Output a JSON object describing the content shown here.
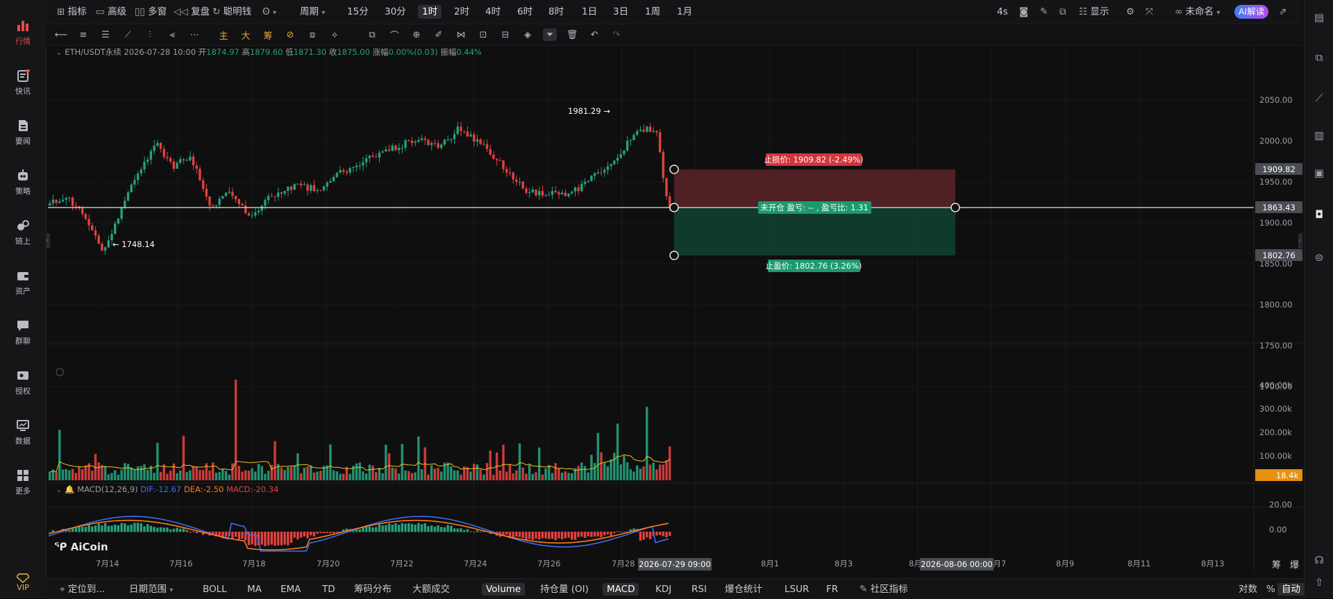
{
  "left_sidebar": {
    "items": [
      {
        "label": "行情",
        "icon": "bar-chart-icon",
        "active": true
      },
      {
        "label": "快讯",
        "icon": "news-flash-icon",
        "dot": true
      },
      {
        "label": "要闻",
        "icon": "document-icon"
      },
      {
        "label": "策略",
        "icon": "robot-icon"
      },
      {
        "label": "链上",
        "icon": "chain-icon"
      },
      {
        "label": "资产",
        "icon": "wallet-icon"
      },
      {
        "label": "群聊",
        "icon": "chat-icon"
      },
      {
        "label": "授权",
        "icon": "key-icon"
      },
      {
        "label": "数据",
        "icon": "monitor-icon"
      },
      {
        "label": "更多",
        "icon": "grid-icon"
      }
    ],
    "vip_label": "VIP"
  },
  "top_bar": {
    "indicators": "指标",
    "advanced": "高级",
    "multi_window": "多窗",
    "replay": "复盘",
    "smart_money": "聪明钱",
    "period": "周期",
    "timeframes": [
      "15分",
      "30分",
      "1时",
      "2时",
      "4时",
      "6时",
      "8时",
      "1日",
      "3日",
      "1周",
      "1月"
    ],
    "selected_timeframe": "1时",
    "countdown": "4s",
    "display": "显示",
    "layout_name": "未命名",
    "ai_button": "AI解读"
  },
  "legend": {
    "symbol": "ETH/USDT永续",
    "time": "2026-07-28 10:00",
    "open_label": "开",
    "open": "1874.97",
    "high_label": "高",
    "high": "1879.60",
    "low_label": "低",
    "low": "1871.30",
    "close_label": "收",
    "close": "1875.00",
    "change_label": "涨幅",
    "change": "0.00%(0.03)",
    "amplitude_label": "振幅",
    "amplitude": "0.44%"
  },
  "annotations": {
    "high_marker": "1981.29",
    "low_marker": "1748.14",
    "stop_loss": "止损价: 1909.82 (-2.49%)",
    "position": "未开仓  盈亏: -- , 盈亏比: 1.31",
    "take_profit": "止盈价: 1802.76 (3.26%)"
  },
  "price_axis": {
    "ticks": [
      "2050.00",
      "2000.00",
      "1950.00",
      "1900.00",
      "1850.00",
      "1800.00",
      "1750.00",
      "1700.00"
    ],
    "badge_sl": "1909.82",
    "badge_entry": "1863.43",
    "badge_tp": "1802.76"
  },
  "volume_axis": {
    "ticks": [
      "400.00k",
      "300.00k",
      "200.00k",
      "100.00k"
    ],
    "badge": "18.4k"
  },
  "macd_legend": {
    "name": "MACD(12,26,9)",
    "dif": "DIF:-12.67",
    "dea": "DEA:-2.50",
    "macd": "MACD:-20.34"
  },
  "macd_axis": {
    "ticks": [
      "20.00",
      "0.00"
    ]
  },
  "time_axis": {
    "labels": [
      "7月14",
      "7月16",
      "7月18",
      "7月20",
      "7月22",
      "7月24",
      "7月26",
      "7月28",
      "8月1",
      "8月3",
      "8月5",
      "8月7",
      "8月9",
      "8月11",
      "8月13"
    ],
    "badge_start": "2026-07-29 09:00",
    "badge_end": "2026-08-06 00:00",
    "corner_a": "筹",
    "corner_b": "爆"
  },
  "logo_text": "AiCoin",
  "bottom_bar": {
    "locate": "定位到...",
    "date_range": "日期范围",
    "tabs": [
      "BOLL",
      "MA",
      "EMA",
      "TD",
      "筹码分布",
      "大额成交",
      "Volume",
      "持仓量 (OI)",
      "MACD",
      "KDJ",
      "RSI",
      "爆仓统计",
      "LSUR",
      "FR"
    ],
    "selected_tabs": [
      "Volume",
      "MACD"
    ],
    "community": "社区指标",
    "log": "对数",
    "percent": "%",
    "auto": "自动"
  },
  "colors": {
    "up": "#26a17b",
    "down": "#e2413f",
    "accent": "#e84b4b",
    "yellow": "#f0c419",
    "orange": "#ff7a1a",
    "blue": "#3d6df2"
  }
}
